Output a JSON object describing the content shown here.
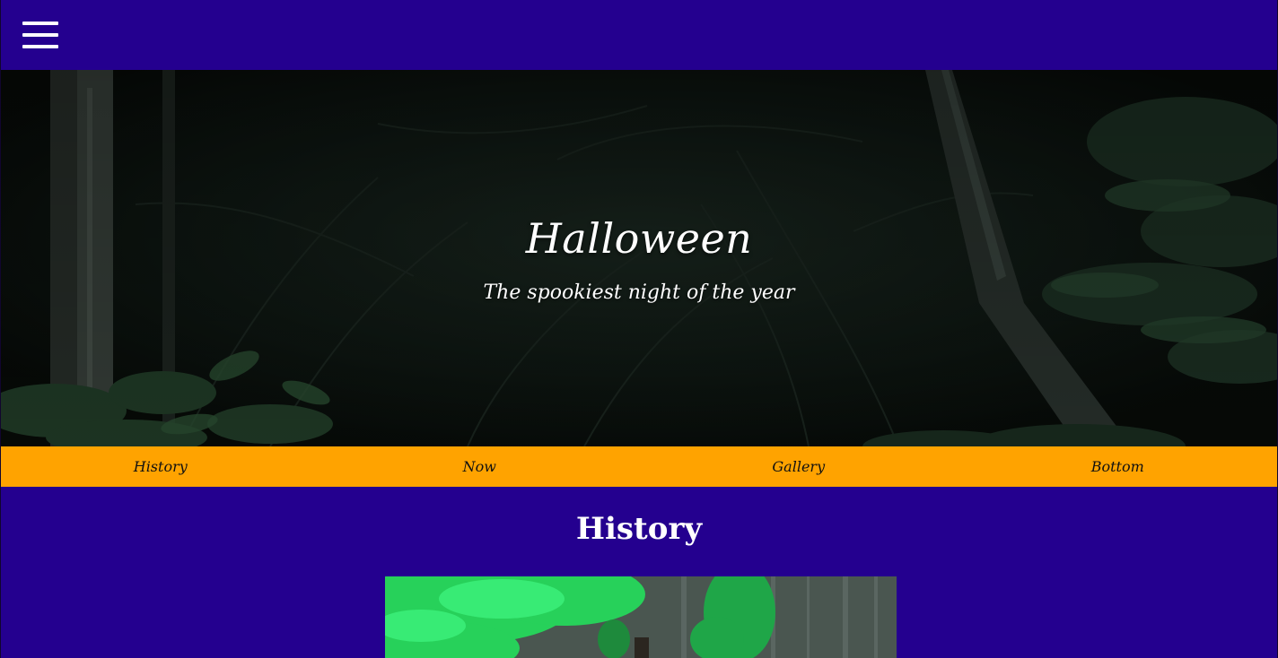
{
  "header": {
    "menu_icon": "hamburger-menu-icon",
    "background_color": "#24008f"
  },
  "hero": {
    "title": "Halloween",
    "subtitle": "The spookiest night of the year",
    "background_image": "dark-forest-image"
  },
  "nav": {
    "background_color": "#ffa300",
    "items": [
      {
        "label": "History"
      },
      {
        "label": "Now"
      },
      {
        "label": "Gallery"
      },
      {
        "label": "Bottom"
      }
    ]
  },
  "history": {
    "heading": "History",
    "image": "green-smoke-witch-image"
  }
}
